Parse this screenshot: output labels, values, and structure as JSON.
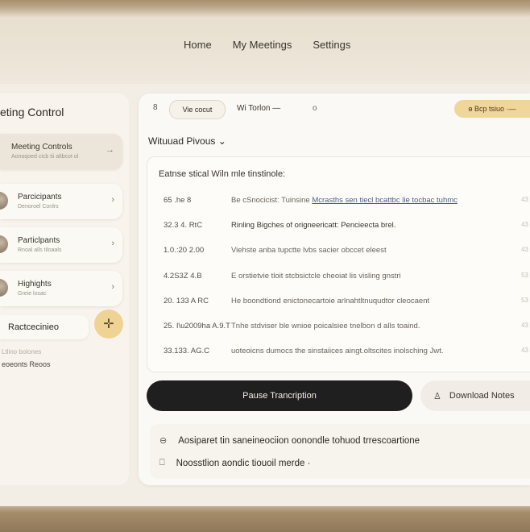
{
  "nav": {
    "items": [
      "Home",
      "My Meetings",
      "Settings"
    ]
  },
  "sidebar": {
    "title": "eting Control",
    "cards": [
      {
        "label": "Meeting Controls",
        "sub": "Aonoqoed cicb tii altbcot ol",
        "chev": "→"
      },
      {
        "label": "Parcicipants",
        "sub": "Denoroel Conlrs",
        "chev": "›"
      },
      {
        "label": "Particlpants",
        "sub": "Rnoal alls tiloaals",
        "chev": "›"
      },
      {
        "label": "Highights",
        "sub": "Greie losac",
        "chev": "›"
      }
    ],
    "record_label": "Ractcecinieo",
    "small_text": "Ltlino bolones",
    "recent_label": "eoeonts Reoos"
  },
  "toolbar": {
    "icon1": "8",
    "view_pill": "Vie cocut",
    "label": "Wi  Torlon —",
    "mic": "o",
    "sync_pill": "ɵ Bcp tsiuo ·—"
  },
  "transcript": {
    "heading": "Wituuad Pivous ⌄",
    "box_title": "Eatnse stical Wiln mle tinstinole:",
    "rows": [
      {
        "ts": "65 .he    8",
        "text": "Be cSnocicist: Tuinsine ",
        "link": "Mcrasths sen tiecl bcattbc lie tocbac tuhmc",
        "n": "43"
      },
      {
        "ts": "32.3    4. RtC",
        "text": "Rinling Bigches of origneericatt: Pencieecta brel.",
        "link": "",
        "n": "43"
      },
      {
        "ts": "1.0.:20  2.00",
        "text": "Viehste anba tupctte lvbs sacier obccet eleest",
        "link": "",
        "n": "43"
      },
      {
        "ts": "4.2S3Z  4.B",
        "text": "E orstietvie tloit stcbsictcle cheoiat lis visling gnstri",
        "link": "",
        "n": "53"
      },
      {
        "ts": "20. 133  A RC",
        "text": "He boondtiond enictonecartoie arlnahtltnuqudtor cleocaent",
        "link": "",
        "n": "53"
      },
      {
        "ts": "25. I\\u2009ha   A.9.T",
        "text": "Tnhe stdviser ble wnioe poicalsiee tnelbon d alls toaind.",
        "link": "",
        "n": "43"
      },
      {
        "ts": "33.133. AG.C",
        "text": "uoteoicns dumocs the sinstaiices aingt.oltscites inolsching Jwt.",
        "link": "",
        "n": "43"
      }
    ]
  },
  "actions": {
    "pause": "Pause Trancription",
    "download": "Download Notes",
    "download_icon": "♙"
  },
  "notes": [
    {
      "icon": "⊖",
      "text": "Aosiparet tin saneineociion oonondle tohuod trrescoartione"
    },
    {
      "icon": "⎕",
      "text": "Noosstlion aondic tiouoil merde ·"
    }
  ]
}
